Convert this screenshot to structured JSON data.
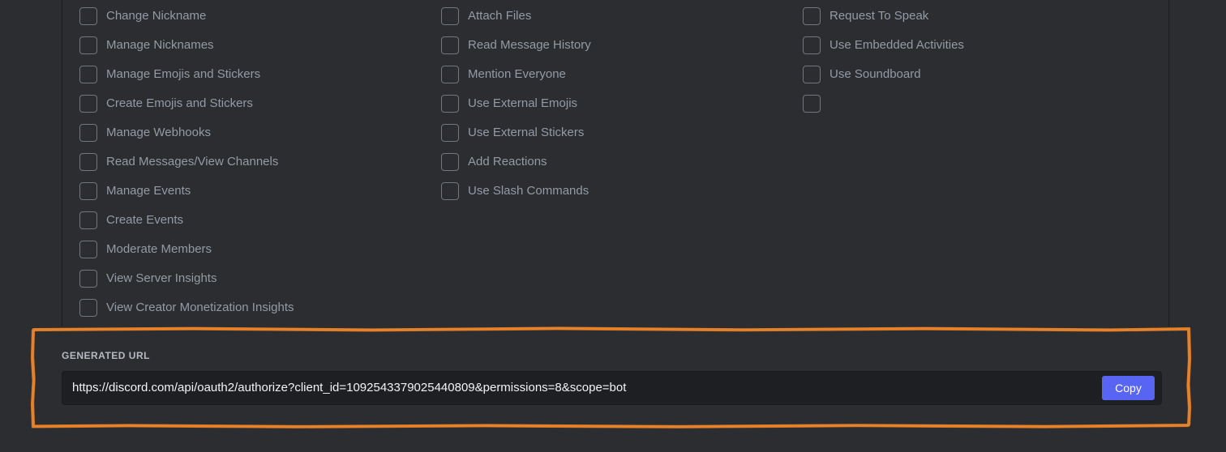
{
  "theme": {
    "page_background": "#2b2d31",
    "accent_blurple": "#5865f2",
    "annotation_orange": "#e8822a",
    "label_color": "#949ba4",
    "url_text_color": "#f2f3f5",
    "input_background": "#1e1f22",
    "checkbox_border": "#72767d"
  },
  "permissions": {
    "columns": [
      {
        "name": "column-1",
        "items": [
          {
            "label": "Change Nickname",
            "checked": false
          },
          {
            "label": "Manage Nicknames",
            "checked": false
          },
          {
            "label": "Manage Emojis and Stickers",
            "checked": false
          },
          {
            "label": "Create Emojis and Stickers",
            "checked": false
          },
          {
            "label": "Manage Webhooks",
            "checked": false
          },
          {
            "label": "Read Messages/View Channels",
            "checked": false
          },
          {
            "label": "Manage Events",
            "checked": false
          },
          {
            "label": "Create Events",
            "checked": false
          },
          {
            "label": "Moderate Members",
            "checked": false
          },
          {
            "label": "View Server Insights",
            "checked": false
          },
          {
            "label": "View Creator Monetization Insights",
            "checked": false
          }
        ]
      },
      {
        "name": "column-2",
        "items": [
          {
            "label": "Attach Files",
            "checked": false
          },
          {
            "label": "Read Message History",
            "checked": false
          },
          {
            "label": "Mention Everyone",
            "checked": false
          },
          {
            "label": "Use External Emojis",
            "checked": false
          },
          {
            "label": "Use External Stickers",
            "checked": false
          },
          {
            "label": "Add Reactions",
            "checked": false
          },
          {
            "label": "Use Slash Commands",
            "checked": false
          }
        ]
      },
      {
        "name": "column-3",
        "items": [
          {
            "label": "Request To Speak",
            "checked": false
          },
          {
            "label": "Use Embedded Activities",
            "checked": false
          },
          {
            "label": "Use Soundboard",
            "checked": false
          },
          {
            "label": "",
            "checked": false
          }
        ]
      }
    ]
  },
  "generated_url": {
    "section_label": "GENERATED URL",
    "url_value": "https://discord.com/api/oauth2/authorize?client_id=1092543379025440809&permissions=8&scope=bot",
    "url_placeholder": "",
    "copy_label": "Copy"
  },
  "annotation": {
    "shape": "dashed-rectangle",
    "color": "#e8822a",
    "target": "generated-url-section"
  }
}
